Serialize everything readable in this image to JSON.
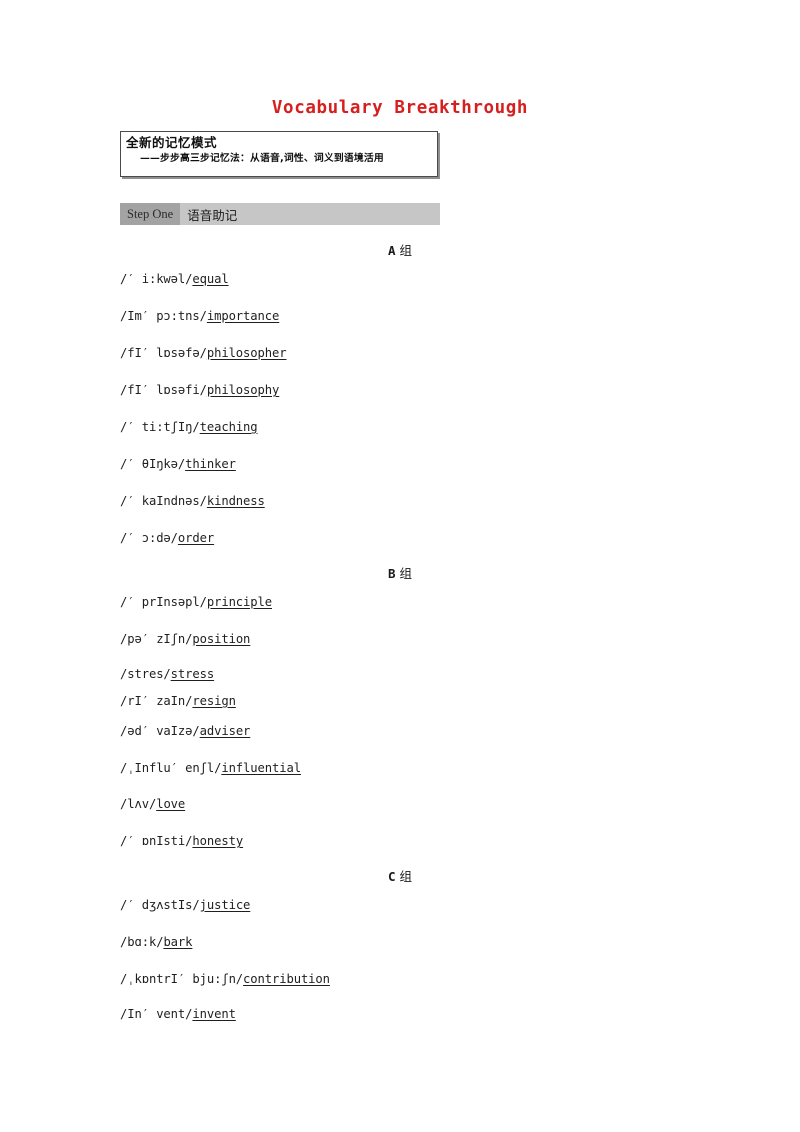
{
  "title": "Vocabulary Breakthrough",
  "mode_box": {
    "heading": "全新的记忆模式",
    "subheading": "——步步高三步记忆法：从语音,词性、词义到语境活用"
  },
  "step_bar": {
    "badge": "Step One",
    "title": "语音助记"
  },
  "groups": [
    {
      "label": "A",
      "label_suffix": "组",
      "entries": [
        {
          "ipa": "/′ i:kwəl/",
          "word": "equal"
        },
        {
          "ipa": "/Im′ pɔ:tns/",
          "word": "importance"
        },
        {
          "ipa": "/fI′ lɒsəfə/",
          "word": "philosopher"
        },
        {
          "ipa": "/fI′ lɒsəfi/",
          "word": "philosophy"
        },
        {
          "ipa": "/′ ti:tʃIŋ/",
          "word": "teaching"
        },
        {
          "ipa": "/′ θIŋkə/",
          "word": "thinker"
        },
        {
          "ipa": "/′ kaIndnəs/",
          "word": "kindness"
        },
        {
          "ipa": "/′ ɔ:də/",
          "word": "order"
        }
      ]
    },
    {
      "label": "B",
      "label_suffix": "组",
      "entries": [
        {
          "ipa": "/′ prInsəpl/",
          "word": "principle"
        },
        {
          "ipa": "/pə′ zIʃn/",
          "word": "position"
        },
        {
          "ipa": "/stres/",
          "word": "stress"
        },
        {
          "ipa": "/rI′ zaIn/",
          "word": "resign"
        },
        {
          "ipa": "/əd′ vaIzə/",
          "word": "adviser"
        },
        {
          "ipa": "/ˌInflu′ enʃl/",
          "word": "influential"
        },
        {
          "ipa": "/lʌv/",
          "word": "love"
        },
        {
          "ipa": "/′ ɒnIsti/",
          "word": "honesty"
        }
      ]
    },
    {
      "label": "C",
      "label_suffix": "组",
      "entries": [
        {
          "ipa": "/′ dʒʌstIs/",
          "word": "justice"
        },
        {
          "ipa": "/bɑ:k/",
          "word": "bark"
        },
        {
          "ipa": "/ˌkɒntrI′ bju:ʃn/",
          "word": "contribution"
        },
        {
          "ipa": "/In′ vent/",
          "word": "invent"
        }
      ]
    }
  ]
}
